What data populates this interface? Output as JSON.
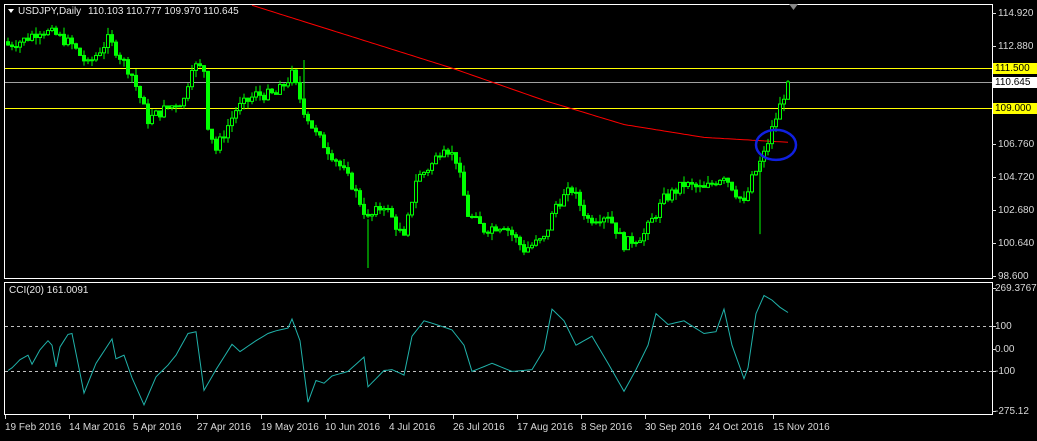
{
  "header": {
    "symbol_label": "USDJPY,Daily",
    "ohlc": "110.103 110.777 109.970 110.645"
  },
  "indicator": {
    "label": "CCI(20) 161.0091"
  },
  "colors": {
    "background": "#000000",
    "candle": "#00ff00",
    "ma": "#ff0000",
    "cci": "#20b2aa",
    "level": "#ffff00",
    "price_line": "#a0a0a0",
    "circle": "#1020e0"
  },
  "chart_data": [
    {
      "type": "candlestick",
      "title": "USDJPY,Daily",
      "ylim": [
        98.6,
        114.92
      ],
      "y_ticks": [
        "114.920",
        "112.880",
        "106.760",
        "104.720",
        "102.680",
        "100.640",
        "98.600"
      ],
      "y_tick_values": [
        114.92,
        112.88,
        106.76,
        104.72,
        102.68,
        100.64,
        98.6
      ],
      "x_tick_labels": [
        "19 Feb 2016",
        "14 Mar 2016",
        "5 Apr 2016",
        "27 Apr 2016",
        "19 May 2016",
        "10 Jun 2016",
        "4 Jul 2016",
        "26 Jul 2016",
        "17 Aug 2016",
        "8 Sep 2016",
        "30 Sep 2016",
        "24 Oct 2016",
        "15 Nov 2016"
      ],
      "bars_between_x_ticks": 16,
      "bar_count": 196,
      "close_keypoints": [
        [
          0,
          112.94
        ],
        [
          4,
          113.25
        ],
        [
          8,
          113.87
        ],
        [
          12,
          113.56
        ],
        [
          16,
          112.94
        ],
        [
          20,
          111.7
        ],
        [
          25,
          113.25
        ],
        [
          27,
          112.63
        ],
        [
          31,
          111.09
        ],
        [
          35,
          108.3
        ],
        [
          39,
          108.92
        ],
        [
          44,
          109.54
        ],
        [
          46,
          111.7
        ],
        [
          49,
          111.4
        ],
        [
          50,
          108.0
        ],
        [
          52,
          106.45
        ],
        [
          57,
          108.92
        ],
        [
          62,
          109.85
        ],
        [
          67,
          109.85
        ],
        [
          71,
          111.09
        ],
        [
          74,
          108.92
        ],
        [
          77,
          107.38
        ],
        [
          82,
          105.83
        ],
        [
          86,
          104.28
        ],
        [
          90,
          102.12
        ],
        [
          94,
          103.05
        ],
        [
          99,
          100.88
        ],
        [
          102,
          104.59
        ],
        [
          106,
          105.52
        ],
        [
          109,
          106.76
        ],
        [
          112,
          105.83
        ],
        [
          115,
          102.43
        ],
        [
          119,
          101.5
        ],
        [
          124,
          101.81
        ],
        [
          129,
          100.26
        ],
        [
          134,
          100.88
        ],
        [
          137,
          103.05
        ],
        [
          141,
          103.97
        ],
        [
          145,
          102.12
        ],
        [
          150,
          102.43
        ],
        [
          154,
          100.57
        ],
        [
          159,
          101.19
        ],
        [
          164,
          103.36
        ],
        [
          169,
          104.28
        ],
        [
          174,
          103.97
        ],
        [
          179,
          104.9
        ],
        [
          184,
          103.05
        ],
        [
          186,
          104.59
        ],
        [
          189,
          106.14
        ],
        [
          191,
          107.69
        ],
        [
          194,
          109.85
        ],
        [
          195,
          110.645
        ]
      ],
      "ma_keypoints": [
        [
          61,
          115.4
        ],
        [
          111,
          111.5
        ],
        [
          134,
          109.5
        ],
        [
          154,
          108.0
        ],
        [
          174,
          107.2
        ],
        [
          195,
          106.9
        ]
      ],
      "levels": [
        {
          "label": "111.500",
          "value": 111.5
        },
        {
          "label": "109.000",
          "value": 109.0
        }
      ],
      "current_price": {
        "label": "110.645",
        "value": 110.645
      },
      "annotation": {
        "type": "ellipse",
        "bar": 193,
        "value": 106.8
      }
    },
    {
      "type": "line",
      "title": "CCI(20) 161.0091",
      "ylim": [
        -275.12,
        269.3767
      ],
      "y_ticks": [
        "269.3767",
        "100",
        "0.00",
        "-100",
        "-275.12"
      ],
      "y_tick_values": [
        269.3767,
        100,
        0,
        -100,
        -275.12
      ],
      "dashed_levels": [
        100,
        -100
      ],
      "keypoints": [
        [
          0,
          -96
        ],
        [
          1,
          -84
        ],
        [
          3,
          -48
        ],
        [
          5,
          -28
        ],
        [
          6,
          -68
        ],
        [
          8,
          -4
        ],
        [
          10,
          36
        ],
        [
          11,
          16
        ],
        [
          12,
          -80
        ],
        [
          13,
          8
        ],
        [
          15,
          64
        ],
        [
          16,
          68
        ],
        [
          19,
          -196
        ],
        [
          22,
          -64
        ],
        [
          26,
          44
        ],
        [
          27,
          -44
        ],
        [
          29,
          -28
        ],
        [
          31,
          -128
        ],
        [
          34,
          -248
        ],
        [
          37,
          -124
        ],
        [
          40,
          -72
        ],
        [
          42,
          -28
        ],
        [
          45,
          68
        ],
        [
          47,
          76
        ],
        [
          49,
          -184
        ],
        [
          52,
          -92
        ],
        [
          56,
          20
        ],
        [
          58,
          -12
        ],
        [
          60,
          12
        ],
        [
          62,
          36
        ],
        [
          65,
          68
        ],
        [
          67,
          80
        ],
        [
          70,
          92
        ],
        [
          71,
          132
        ],
        [
          73,
          36
        ],
        [
          75,
          -236
        ],
        [
          77,
          -140
        ],
        [
          79,
          -152
        ],
        [
          81,
          -120
        ],
        [
          85,
          -100
        ],
        [
          89,
          -36
        ],
        [
          90,
          -168
        ],
        [
          94,
          -96
        ],
        [
          96,
          -92
        ],
        [
          99,
          -116
        ],
        [
          101,
          56
        ],
        [
          104,
          124
        ],
        [
          107,
          108
        ],
        [
          111,
          84
        ],
        [
          114,
          16
        ],
        [
          116,
          -100
        ],
        [
          121,
          -64
        ],
        [
          126,
          -100
        ],
        [
          131,
          -92
        ],
        [
          134,
          -4
        ],
        [
          136,
          176
        ],
        [
          139,
          124
        ],
        [
          142,
          16
        ],
        [
          146,
          56
        ],
        [
          150,
          -64
        ],
        [
          154,
          -188
        ],
        [
          157,
          -92
        ],
        [
          160,
          16
        ],
        [
          162,
          156
        ],
        [
          165,
          108
        ],
        [
          169,
          124
        ],
        [
          174,
          68
        ],
        [
          177,
          76
        ],
        [
          179,
          176
        ],
        [
          181,
          16
        ],
        [
          184,
          -132
        ],
        [
          185,
          -84
        ],
        [
          187,
          156
        ],
        [
          189,
          236
        ],
        [
          191,
          216
        ],
        [
          193,
          184
        ],
        [
          195,
          161
        ]
      ]
    }
  ]
}
